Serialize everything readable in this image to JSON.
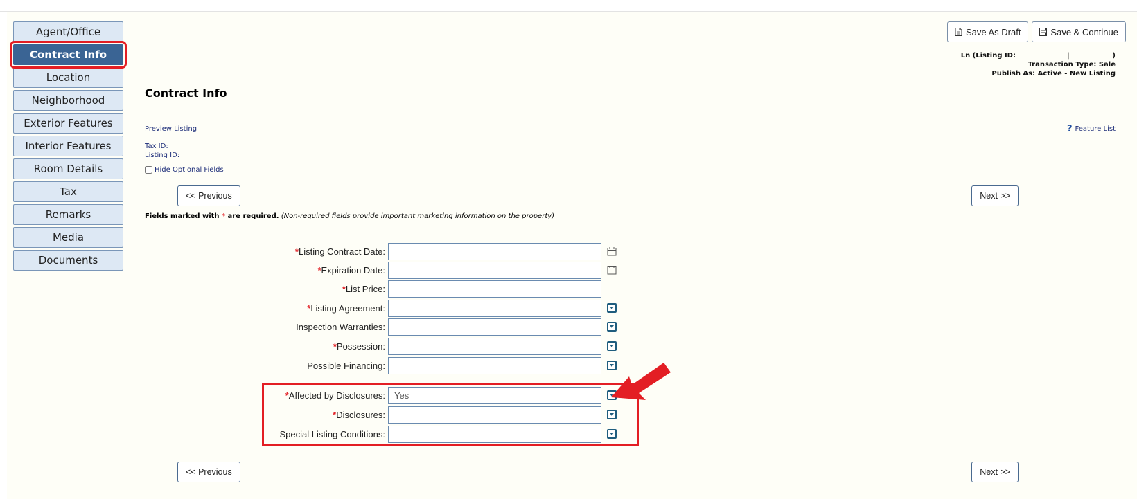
{
  "sidebar": {
    "items": [
      {
        "label": "Agent/Office"
      },
      {
        "label": "Contract Info",
        "active": true
      },
      {
        "label": "Location"
      },
      {
        "label": "Neighborhood"
      },
      {
        "label": "Exterior Features"
      },
      {
        "label": "Interior Features"
      },
      {
        "label": "Room Details"
      },
      {
        "label": "Tax"
      },
      {
        "label": "Remarks"
      },
      {
        "label": "Media"
      },
      {
        "label": "Documents"
      }
    ]
  },
  "toolbar": {
    "save_draft_label": "Save As Draft",
    "save_continue_label": "Save & Continue"
  },
  "listing_info": {
    "ln_label": "Ln (Listing ID:",
    "pipe": "|",
    "close_paren": ")",
    "transaction_type": "Transaction Type: Sale",
    "publish_as": "Publish As: Active - New Listing"
  },
  "page": {
    "title": "Contract Info",
    "preview_link": "Preview Listing",
    "feature_list_link": "Feature List",
    "tax_id_label": "Tax ID:",
    "listing_id_label": "Listing ID:",
    "hide_optional_label": "Hide Optional Fields",
    "previous_label": "<< Previous",
    "next_label": "Next >>",
    "required_note_bold_a": "Fields marked with ",
    "required_star": "*",
    "required_note_bold_b": " are required.",
    "required_note_italic": "(Non-required fields provide important marketing information on the property)"
  },
  "form": {
    "fields": [
      {
        "label": "Listing Contract Date:",
        "required": true,
        "value": "",
        "control": "date"
      },
      {
        "label": "Expiration Date:",
        "required": true,
        "value": "",
        "control": "date"
      },
      {
        "label": "List Price:",
        "required": true,
        "value": "",
        "control": "text"
      },
      {
        "label": "Listing Agreement:",
        "required": true,
        "value": "",
        "control": "select"
      },
      {
        "label": "Inspection Warranties:",
        "required": false,
        "value": "",
        "control": "select"
      },
      {
        "label": "Possession:",
        "required": true,
        "value": "",
        "control": "select"
      },
      {
        "label": "Possible Financing:",
        "required": false,
        "value": "",
        "control": "select"
      },
      {
        "label": "Affected by Disclosures:",
        "required": true,
        "value": "Yes",
        "control": "select"
      },
      {
        "label": "Disclosures:",
        "required": true,
        "value": "",
        "control": "select"
      },
      {
        "label": "Special Listing Conditions:",
        "required": false,
        "value": "",
        "control": "select"
      }
    ]
  },
  "colors": {
    "active_nav": "#3a6494",
    "nav_bg": "#dde8f4",
    "highlight": "#e31e24",
    "dropdown_icon": "#1f5d7e"
  },
  "icons": [
    "document-icon",
    "save-icon",
    "question-icon",
    "calendar-icon",
    "dropdown-arrow-icon",
    "pointer-arrow-icon"
  ]
}
